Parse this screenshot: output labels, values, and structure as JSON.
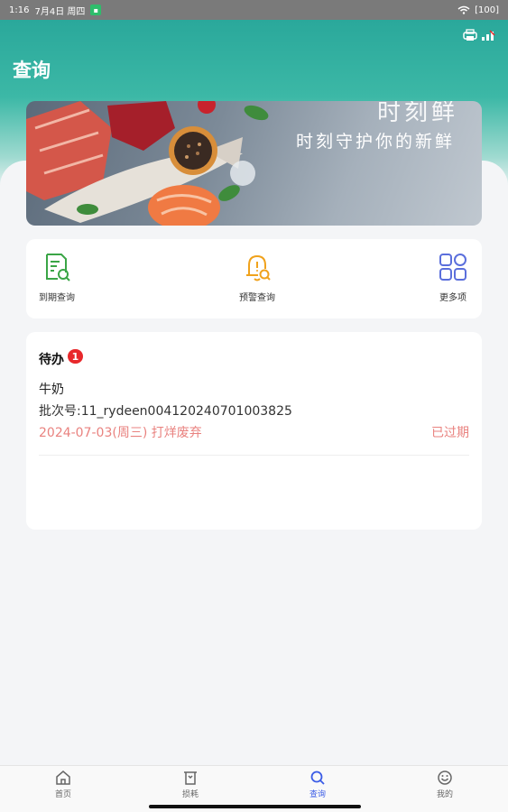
{
  "status_bar": {
    "time": "1:16",
    "date": "7月4日 周四",
    "battery": "[100]"
  },
  "header": {
    "title": "查询"
  },
  "banner": {
    "brand_text": "时刻鲜",
    "slogan": "时刻守护你的新鲜"
  },
  "menu": {
    "items": [
      {
        "label": "到期查询",
        "icon": "document-search-icon",
        "color": "#3aa546"
      },
      {
        "label": "预警查询",
        "icon": "bell-search-icon",
        "color": "#f0a21c"
      },
      {
        "label": "更多项",
        "icon": "grid-apps-icon",
        "color": "#5b6fdc"
      }
    ]
  },
  "todo": {
    "title": "待办",
    "count": "1",
    "items": [
      {
        "name": "牛奶",
        "batch": "批次号:11_rydeen004120240701003825",
        "date_action": "2024-07-03(周三) 打烊废弃",
        "status": "已过期"
      }
    ]
  },
  "tabbar": {
    "tabs": [
      {
        "label": "首页",
        "icon": "home-icon",
        "active": false
      },
      {
        "label": "损耗",
        "icon": "trash-box-icon",
        "active": false
      },
      {
        "label": "查询",
        "icon": "search-icon",
        "active": true
      },
      {
        "label": "我的",
        "icon": "smiley-icon",
        "active": false
      }
    ]
  },
  "colors": {
    "header": "#2aa89b",
    "accent": "#3b5ce6",
    "warning_text": "#e9827f",
    "badge": "#e8282b"
  }
}
